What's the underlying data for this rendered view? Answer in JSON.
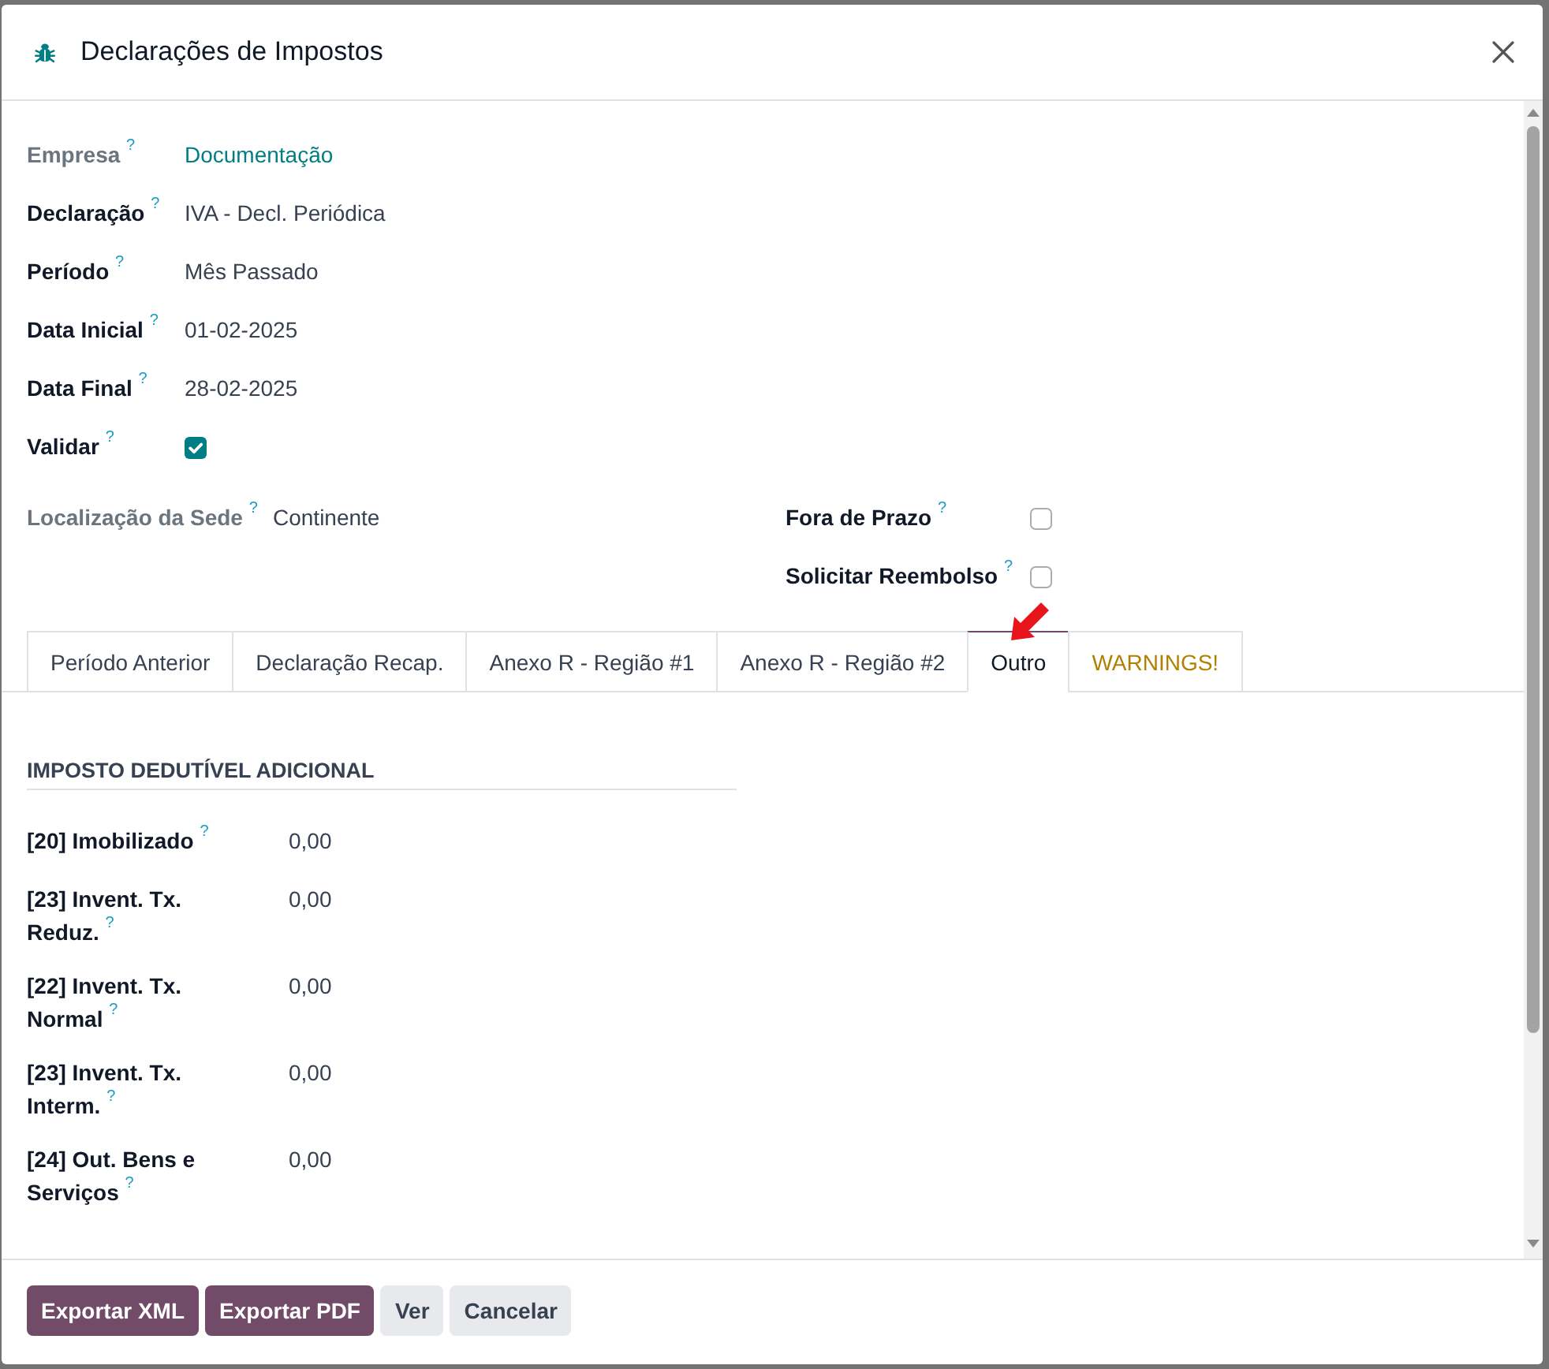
{
  "dialog": {
    "title": "Declarações de Impostos"
  },
  "fields": [
    {
      "kind": "link",
      "label": "Empresa",
      "help": "?",
      "readonly": true,
      "value": "Documentação"
    },
    {
      "kind": "text",
      "label": "Declaração",
      "help": "?",
      "readonly": false,
      "value": "IVA - Decl. Periódica"
    },
    {
      "kind": "text",
      "label": "Período",
      "help": "?",
      "readonly": false,
      "value": "Mês Passado"
    },
    {
      "kind": "text",
      "label": "Data Inicial",
      "help": "?",
      "readonly": false,
      "value": "01-02-2025"
    },
    {
      "kind": "text",
      "label": "Data Final",
      "help": "?",
      "readonly": false,
      "value": "28-02-2025"
    },
    {
      "kind": "checkbox",
      "label": "Validar",
      "help": "?",
      "readonly": false,
      "checked": true
    }
  ],
  "group": {
    "left": [
      {
        "kind": "text",
        "label": "Localização da Sede",
        "help": "?",
        "readonly": true,
        "value": "Continente"
      }
    ],
    "right": [
      {
        "kind": "checkbox",
        "label": "Fora de Prazo",
        "help": "?",
        "readonly": false,
        "checked": false
      },
      {
        "kind": "checkbox",
        "label": "Solicitar Reembolso",
        "help": "?",
        "readonly": false,
        "checked": false
      }
    ]
  },
  "tabs": [
    {
      "label": "Período Anterior",
      "kind": "normal",
      "selected": false,
      "marked": false
    },
    {
      "label": "Declaração Recap.",
      "kind": "normal",
      "selected": false,
      "marked": false
    },
    {
      "label": "Anexo R - Região #1",
      "kind": "normal",
      "selected": false,
      "marked": false
    },
    {
      "label": "Anexo R - Região #2",
      "kind": "normal",
      "selected": false,
      "marked": false
    },
    {
      "label": "Outro",
      "kind": "normal",
      "selected": true,
      "marked": true
    },
    {
      "label": "WARNINGS!",
      "kind": "warning",
      "selected": false,
      "marked": false
    }
  ],
  "section": {
    "title": "IMPOSTO DEDUTÍVEL ADICIONAL",
    "rows": [
      {
        "label": "[20] Imobilizado",
        "help": "?",
        "value": "0,00"
      },
      {
        "label": "[23] Invent. Tx. Reduz.",
        "help": "?",
        "value": "0,00"
      },
      {
        "label": "[22] Invent. Tx. Normal",
        "help": "?",
        "value": "0,00"
      },
      {
        "label": "[23] Invent. Tx. Interm.",
        "help": "?",
        "value": "0,00"
      },
      {
        "label": "[24] Out. Bens e Serviços",
        "help": "?",
        "value": "0,00"
      }
    ]
  },
  "buttons": [
    {
      "label": "Exportar XML",
      "kind": "primary"
    },
    {
      "label": "Exportar PDF",
      "kind": "primary"
    },
    {
      "label": "Ver",
      "kind": "secondary"
    },
    {
      "label": "Cancelar",
      "kind": "secondary"
    }
  ]
}
